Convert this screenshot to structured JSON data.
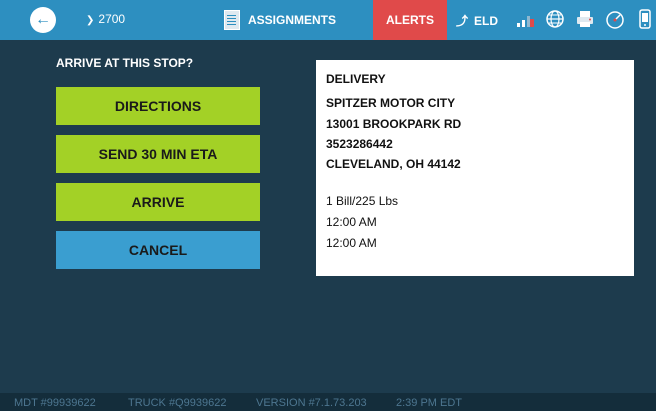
{
  "header": {
    "back_icon": "arrow-left-icon",
    "route_number": "2700",
    "assignments_label": "ASSIGNMENTS",
    "alerts_label": "ALERTS",
    "eld_label": "ELD",
    "status_icons": [
      "signal-icon",
      "globe-icon",
      "printer-icon",
      "gauge-icon",
      "device-icon"
    ]
  },
  "prompt": "ARRIVE AT THIS STOP?",
  "buttons": {
    "directions": "DIRECTIONS",
    "eta": "SEND 30 MIN ETA",
    "arrive": "ARRIVE",
    "cancel": "CANCEL"
  },
  "stop": {
    "type": "DELIVERY",
    "name": "SPITZER MOTOR CITY",
    "street": "13001 BROOKPARK RD",
    "phone": "3523286442",
    "city": "CLEVELAND, OH 44142",
    "bill": "1 Bill/225 Lbs",
    "time1": "12:00 AM",
    "time2": "12:00 AM"
  },
  "footer": {
    "mdt": "MDT #99939622",
    "truck": "TRUCK #Q9939622",
    "version": "VERSION #7.1.73.203",
    "time": "2:39 PM EDT"
  },
  "colors": {
    "background": "#1d3b4d",
    "header": "#2d8fc0",
    "alerts": "#e04a4a",
    "action_button": "#a3d126",
    "cancel_button": "#3a9ed0"
  }
}
